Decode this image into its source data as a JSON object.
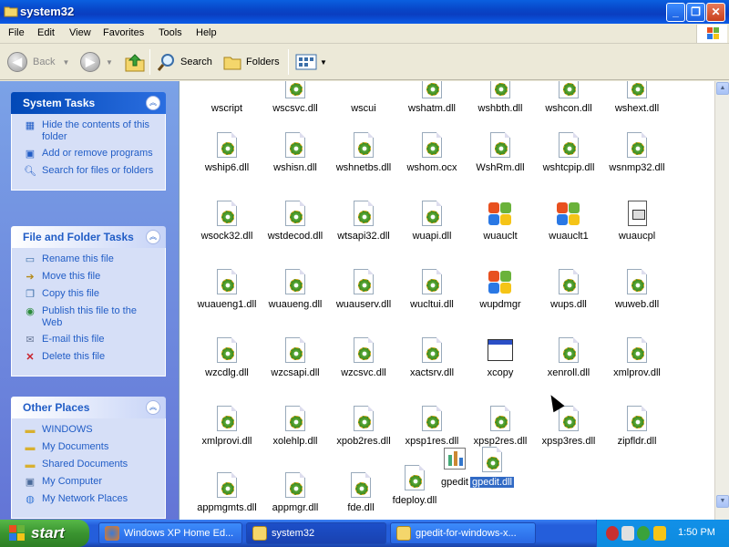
{
  "window": {
    "title": "system32",
    "buttons": [
      "minimize",
      "maximize",
      "close"
    ]
  },
  "menu": [
    "File",
    "Edit",
    "View",
    "Favorites",
    "Tools",
    "Help"
  ],
  "toolbar": {
    "back": "Back",
    "search": "Search",
    "folders": "Folders"
  },
  "system_tasks": {
    "title": "System Tasks",
    "items": [
      {
        "label": "Hide the contents of this folder",
        "icon": "folder-hide-icon"
      },
      {
        "label": "Add or remove programs",
        "icon": "add-remove-icon"
      },
      {
        "label": "Search for files or folders",
        "icon": "search-icon"
      }
    ]
  },
  "file_tasks": {
    "title": "File and Folder Tasks",
    "items": [
      {
        "label": "Rename this file",
        "icon": "rename-icon"
      },
      {
        "label": "Move this file",
        "icon": "move-icon"
      },
      {
        "label": "Copy this file",
        "icon": "copy-icon"
      },
      {
        "label": "Publish this file to the Web",
        "icon": "publish-icon"
      },
      {
        "label": "E-mail this file",
        "icon": "email-icon"
      },
      {
        "label": "Delete this file",
        "icon": "delete-icon"
      }
    ]
  },
  "other_places": {
    "title": "Other Places",
    "items": [
      {
        "label": "WINDOWS",
        "icon": "folder-icon"
      },
      {
        "label": "My Documents",
        "icon": "folder-icon"
      },
      {
        "label": "Shared Documents",
        "icon": "folder-icon"
      },
      {
        "label": "My Computer",
        "icon": "computer-icon"
      },
      {
        "label": "My Network Places",
        "icon": "network-icon"
      }
    ]
  },
  "files": [
    {
      "name": "wscript",
      "type": "script"
    },
    {
      "name": "wscsvc.dll",
      "type": "dll"
    },
    {
      "name": "wscui",
      "type": "cui"
    },
    {
      "name": "wshatm.dll",
      "type": "dll"
    },
    {
      "name": "wshbth.dll",
      "type": "dll"
    },
    {
      "name": "wshcon.dll",
      "type": "dll"
    },
    {
      "name": "wshext.dll",
      "type": "dll"
    },
    {
      "name": "wship6.dll",
      "type": "dll"
    },
    {
      "name": "wshisn.dll",
      "type": "dll"
    },
    {
      "name": "wshnetbs.dll",
      "type": "dll"
    },
    {
      "name": "wshom.ocx",
      "type": "dll"
    },
    {
      "name": "WshRm.dll",
      "type": "dll"
    },
    {
      "name": "wshtcpip.dll",
      "type": "dll"
    },
    {
      "name": "wsnmp32.dll",
      "type": "dll"
    },
    {
      "name": "wsock32.dll",
      "type": "dll"
    },
    {
      "name": "wstdecod.dll",
      "type": "dll"
    },
    {
      "name": "wtsapi32.dll",
      "type": "dll"
    },
    {
      "name": "wuapi.dll",
      "type": "dll"
    },
    {
      "name": "wuauclt",
      "type": "win"
    },
    {
      "name": "wuauclt1",
      "type": "win"
    },
    {
      "name": "wuaucpl",
      "type": "cpl"
    },
    {
      "name": "wuaueng1.dll",
      "type": "dll"
    },
    {
      "name": "wuaueng.dll",
      "type": "dll"
    },
    {
      "name": "wuauserv.dll",
      "type": "dll"
    },
    {
      "name": "wucltui.dll",
      "type": "dll"
    },
    {
      "name": "wupdmgr",
      "type": "win"
    },
    {
      "name": "wups.dll",
      "type": "dll"
    },
    {
      "name": "wuweb.dll",
      "type": "dll"
    },
    {
      "name": "wzcdlg.dll",
      "type": "dll"
    },
    {
      "name": "wzcsapi.dll",
      "type": "dll"
    },
    {
      "name": "wzcsvc.dll",
      "type": "dll"
    },
    {
      "name": "xactsrv.dll",
      "type": "dll"
    },
    {
      "name": "xcopy",
      "type": "exe"
    },
    {
      "name": "xenroll.dll",
      "type": "dll"
    },
    {
      "name": "xmlprov.dll",
      "type": "dll"
    },
    {
      "name": "xmlprovi.dll",
      "type": "dll"
    },
    {
      "name": "xolehlp.dll",
      "type": "dll"
    },
    {
      "name": "xpob2res.dll",
      "type": "dll"
    },
    {
      "name": "xpsp1res.dll",
      "type": "dll"
    },
    {
      "name": "xpsp2res.dll",
      "type": "dll"
    },
    {
      "name": "xpsp3res.dll",
      "type": "dll"
    },
    {
      "name": "zipfldr.dll",
      "type": "dll"
    },
    {
      "name": "appmgmts.dll",
      "type": "dll"
    },
    {
      "name": "appmgr.dll",
      "type": "dll"
    },
    {
      "name": "fde.dll",
      "type": "dll"
    },
    {
      "name": "fdeploy.dll",
      "type": "dll"
    },
    {
      "name": "gpedit",
      "type": "gp"
    },
    {
      "name": "gpedit.dll",
      "type": "dll",
      "selected": true
    }
  ],
  "taskbar": {
    "start": "start",
    "items": [
      {
        "label": "Windows XP Home Ed...",
        "icon": "firefox-icon"
      },
      {
        "label": "system32",
        "icon": "folder-icon",
        "active": true
      },
      {
        "label": "gpedit-for-windows-x...",
        "icon": "folder-icon"
      }
    ],
    "clock": "1:50 PM"
  }
}
